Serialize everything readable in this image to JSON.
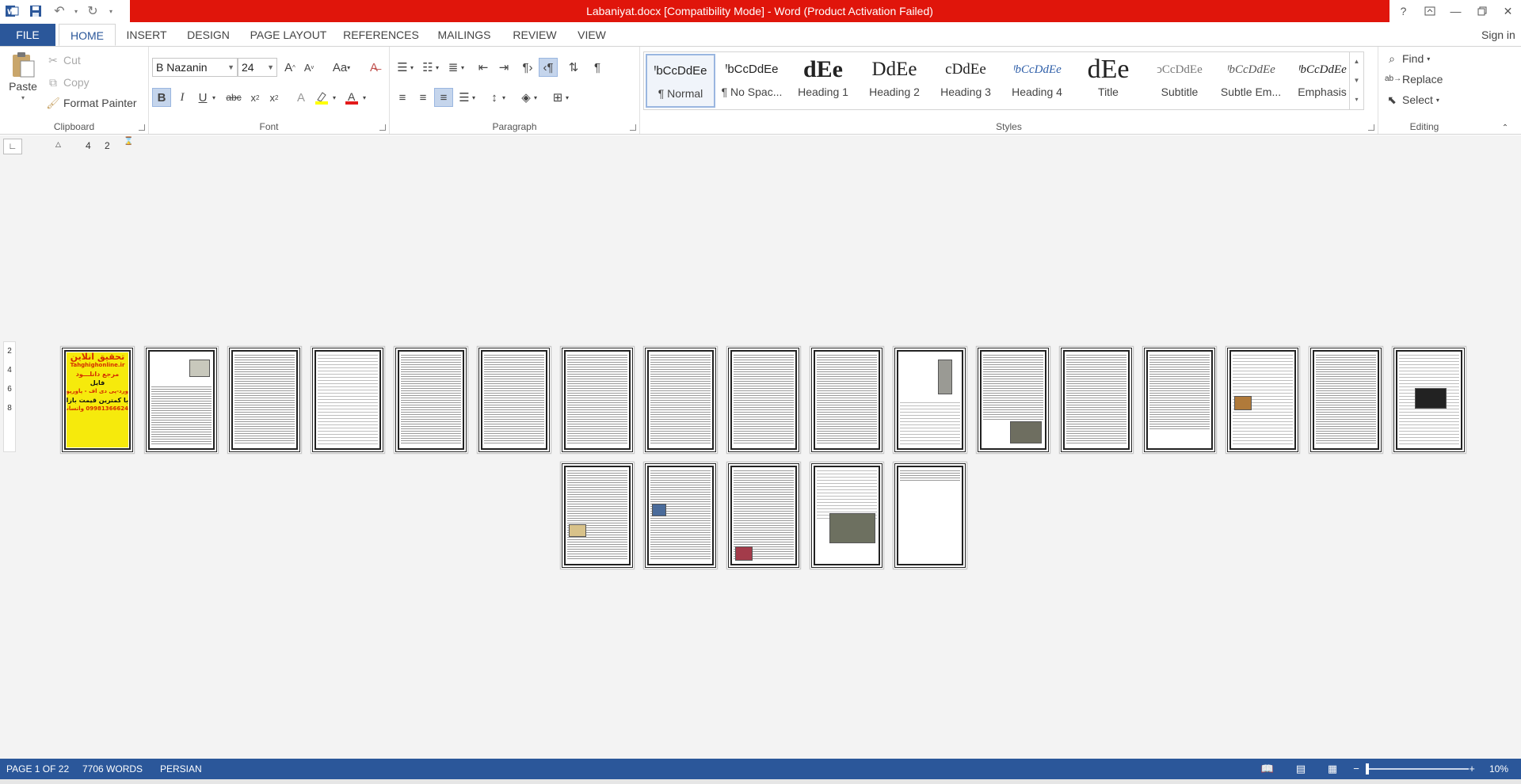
{
  "window": {
    "title": "Labaniyat.docx [Compatibility Mode] -  Word (Product Activation Failed)",
    "help": "?",
    "brand_color": "#2b579a",
    "alert_color": "#e0150b"
  },
  "tabs": {
    "file": "FILE",
    "home": "HOME",
    "insert": "INSERT",
    "design": "DESIGN",
    "page_layout": "PAGE LAYOUT",
    "references": "REFERENCES",
    "mailings": "MAILINGS",
    "review": "REVIEW",
    "view": "VIEW",
    "sign_in": "Sign in"
  },
  "clipboard": {
    "label": "Clipboard",
    "paste": "Paste",
    "cut": "Cut",
    "copy": "Copy",
    "format_painter": "Format Painter"
  },
  "font": {
    "label": "Font",
    "family": "B Nazanin",
    "size": "24",
    "change_case": "Aa",
    "bold": "B",
    "italic": "I",
    "underline": "U",
    "strikethrough": "abc"
  },
  "paragraph": {
    "label": "Paragraph"
  },
  "styles": {
    "label": "Styles",
    "items": [
      {
        "sample": "ꞋbCcDdEe",
        "name": "¶ Normal"
      },
      {
        "sample": "ꞋbCcDdEe",
        "name": "¶ No Spac..."
      },
      {
        "sample": "dEe",
        "name": "Heading 1"
      },
      {
        "sample": "DdEe",
        "name": "Heading 2"
      },
      {
        "sample": "cDdEe",
        "name": "Heading 3"
      },
      {
        "sample": "ꞋbCcDdEe",
        "name": "Heading 4"
      },
      {
        "sample": "dEe",
        "name": "Title"
      },
      {
        "sample": "ↄCcDdEe",
        "name": "Subtitle"
      },
      {
        "sample": "ꞋbCcDdEe",
        "name": "Subtle Em..."
      },
      {
        "sample": "ꞋbCcDdEe",
        "name": "Emphasis"
      }
    ]
  },
  "editing": {
    "label": "Editing",
    "find": "Find",
    "replace": "Replace",
    "select": "Select"
  },
  "ruler": {
    "h_marks": [
      "4",
      "2"
    ],
    "v_marks": [
      "2",
      "4",
      "6",
      "8"
    ]
  },
  "cover_page": {
    "lines": [
      "تحقیق آنلاین",
      "Tahghighonline.ir",
      "مرجع دانلـــود",
      "فایل",
      "ورد-پی دی اف - پاورپوینت",
      "با کمترین قیمت بازار",
      "09981366624 واتساپ"
    ]
  },
  "status": {
    "page": "PAGE 1 OF 22",
    "words": "7706 WORDS",
    "language": "PERSIAN",
    "zoom": "10%",
    "zoom_minus": "−",
    "zoom_plus": "+"
  }
}
